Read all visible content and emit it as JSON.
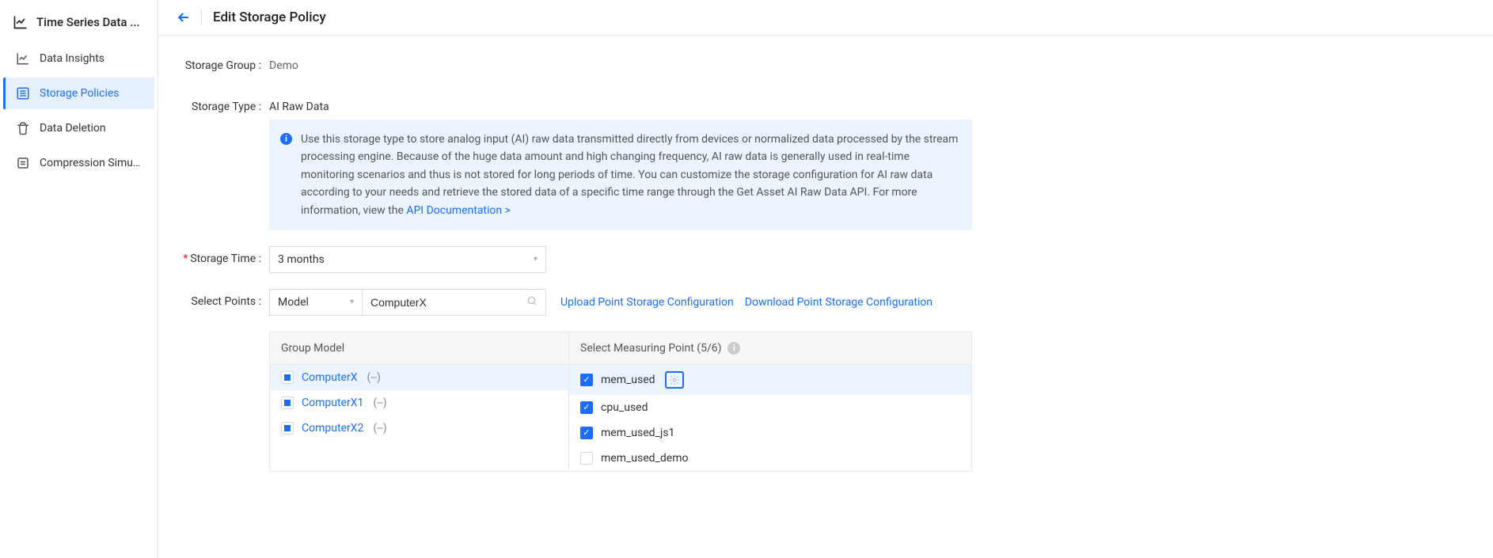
{
  "sidebar": {
    "title": "Time Series Data ...",
    "items": [
      {
        "label": "Data Insights"
      },
      {
        "label": "Storage Policies"
      },
      {
        "label": "Data Deletion"
      },
      {
        "label": "Compression Simul..."
      }
    ],
    "active_index": 1
  },
  "header": {
    "title": "Edit Storage Policy"
  },
  "storage_group": {
    "label": "Storage Group :",
    "value": "Demo"
  },
  "storage_type": {
    "label": "Storage Type :",
    "value": "AI Raw Data",
    "info_text": "Use this storage type to store analog input (AI) raw data transmitted directly from devices or normalized data processed by the stream processing engine. Because of the huge data amount and high changing frequency, AI raw data is generally used in real-time monitoring scenarios and thus is not stored for long periods of time. You can customize the storage configuration for AI raw data according to your needs and retrieve the stored data of a specific time range through the Get Asset AI Raw Data API. For more information, view the ",
    "info_link": "API Documentation >"
  },
  "storage_time": {
    "label": "Storage Time :",
    "value": "3 months"
  },
  "select_points": {
    "label": "Select Points :",
    "mode": "Model",
    "search_value": "ComputerX",
    "upload_link": "Upload Point Storage Configuration",
    "download_link": "Download Point Storage Configuration"
  },
  "table": {
    "head_left": "Group Model",
    "head_right": "Select Measuring Point (5/6)",
    "models": [
      {
        "name": "ComputerX",
        "suffix": "(--)",
        "state": "ind",
        "selected": true
      },
      {
        "name": "ComputerX1",
        "suffix": "(--)",
        "state": "ind",
        "selected": false
      },
      {
        "name": "ComputerX2",
        "suffix": "(--)",
        "state": "ind",
        "selected": false
      }
    ],
    "points": [
      {
        "name": "mem_used",
        "checked": true,
        "gear": true
      },
      {
        "name": "cpu_used",
        "checked": true,
        "gear": false
      },
      {
        "name": "mem_used_js1",
        "checked": true,
        "gear": false
      },
      {
        "name": "mem_used_demo",
        "checked": false,
        "gear": false
      }
    ]
  }
}
